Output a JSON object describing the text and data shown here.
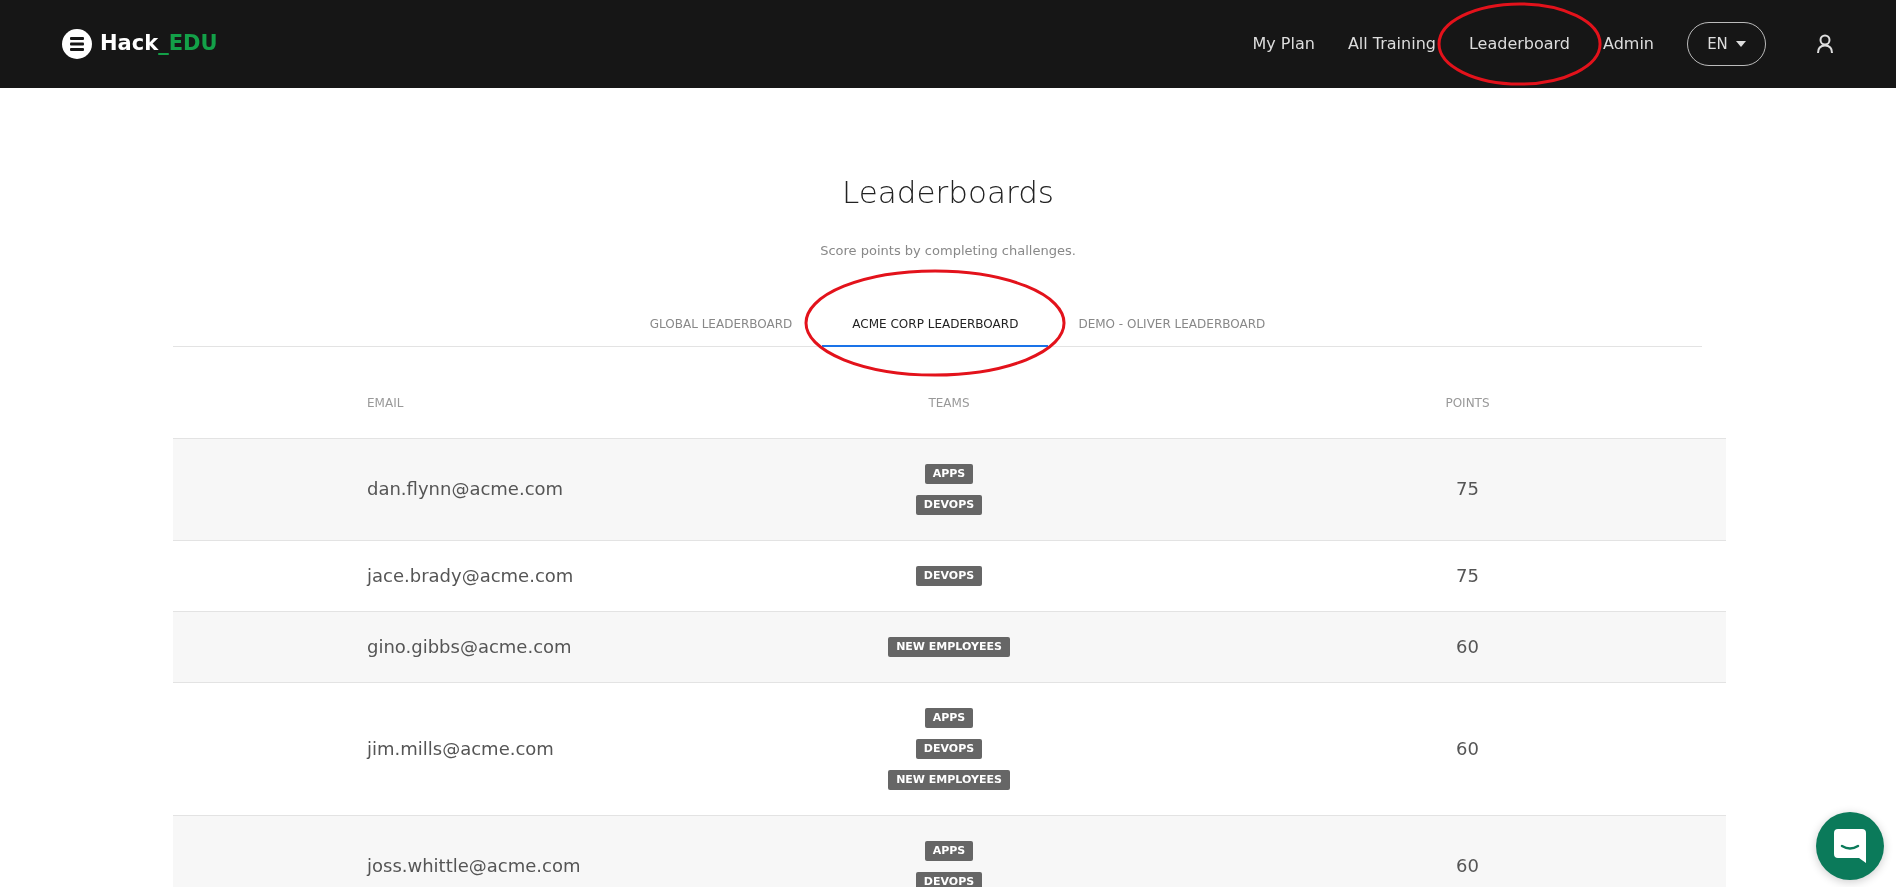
{
  "navbar": {
    "logo": {
      "text": "Hack",
      "accent": "_EDU"
    },
    "links": [
      {
        "label": "My Plan",
        "selected": false
      },
      {
        "label": "All Training",
        "selected": false
      },
      {
        "label": "Leaderboard",
        "selected": false,
        "circled": true
      },
      {
        "label": "Admin",
        "selected": false
      }
    ],
    "language": "EN"
  },
  "heading": {
    "title": "Leaderboards",
    "subtitle": "Score points by completing challenges."
  },
  "tabs": [
    {
      "label": "GLOBAL LEADERBOARD",
      "selected": false
    },
    {
      "label": "ACME CORP LEADERBOARD",
      "selected": true,
      "circled": true
    },
    {
      "label": "DEMO - OLIVER LEADERBOARD",
      "selected": false
    }
  ],
  "table": {
    "columns": [
      "EMAIL",
      "TEAMS",
      "POINTS"
    ],
    "rows": [
      {
        "email": "dan.flynn@acme.com",
        "teams": [
          "APPS",
          "DEVOPS"
        ],
        "points": "75"
      },
      {
        "email": "jace.brady@acme.com",
        "teams": [
          "DEVOPS"
        ],
        "points": "75"
      },
      {
        "email": "gino.gibbs@acme.com",
        "teams": [
          "NEW EMPLOYEES"
        ],
        "points": "60"
      },
      {
        "email": "jim.mills@acme.com",
        "teams": [
          "APPS",
          "DEVOPS",
          "NEW EMPLOYEES"
        ],
        "points": "60"
      },
      {
        "email": "joss.whittle@acme.com",
        "teams": [
          "APPS",
          "DEVOPS"
        ],
        "points": "60"
      }
    ]
  }
}
